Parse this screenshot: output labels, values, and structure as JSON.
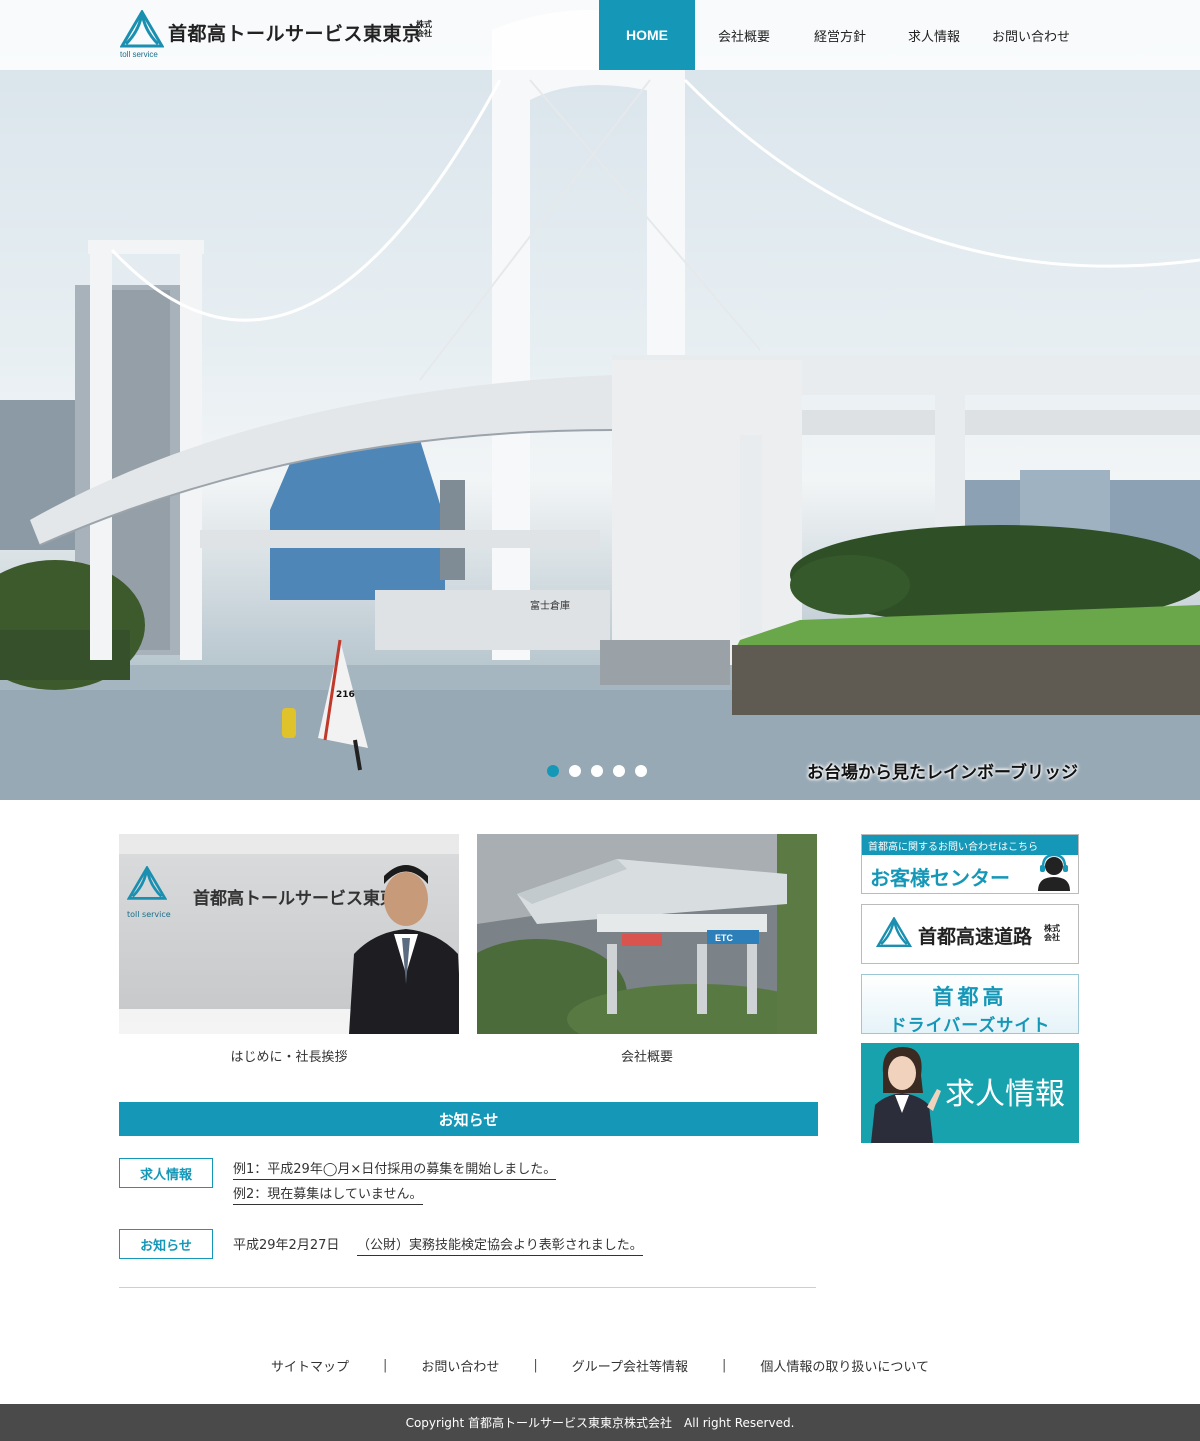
{
  "header": {
    "logo_text": "首都高トールサービス東東京",
    "logo_kabushiki": "株式会社",
    "logo_sub": "toll service",
    "nav": [
      {
        "label": "HOME",
        "active": true
      },
      {
        "label": "会社概要"
      },
      {
        "label": "経営方針"
      },
      {
        "label": "求人情報"
      },
      {
        "label": "お問い合わせ"
      }
    ]
  },
  "hero": {
    "caption": "お台場から見たレインボーブリッジ",
    "slide_count": 5,
    "active_slide": 1,
    "sail_number": "216",
    "warehouse_sign": "富士倉庫"
  },
  "cards": [
    {
      "label": "はじめに・社長挨拶",
      "sign_text": "首都高トールサービス東東京",
      "sign_sub": "toll service"
    },
    {
      "label": "会社概要",
      "booth_sign": "ETC"
    }
  ],
  "news": {
    "heading": "お知らせ",
    "items": [
      {
        "badge": "求人情報",
        "links": [
          "例1：平成29年◯月×日付採用の募集を開始しました。",
          "例2：現在募集はしていません。"
        ]
      },
      {
        "badge": "お知らせ",
        "date": "平成29年2月27日",
        "links": [
          "（公財）実務技能検定協会より表彰されました。"
        ]
      }
    ]
  },
  "sidebar": {
    "center_top": "首都高に関するお問い合わせはこちら",
    "center_main": "お客様センター",
    "shutoko_text": "首都高速道路",
    "shutoko_kabushiki": "株式会社",
    "drivers_line1": "首都高",
    "drivers_line2": "ドライバーズサイト",
    "recruit_text": "求人情報"
  },
  "footer": {
    "links": [
      "サイトマップ",
      "お問い合わせ",
      "グループ会社等情報",
      "個人情報の取り扱いについて"
    ],
    "separator": "|",
    "copyright": "Copyright 首都高トールサービス東東京株式会社　All right Reserved."
  },
  "colors": {
    "accent": "#1597b8",
    "footer_bg": "#4a4a4a",
    "recruit_bg": "#17a2ad"
  }
}
